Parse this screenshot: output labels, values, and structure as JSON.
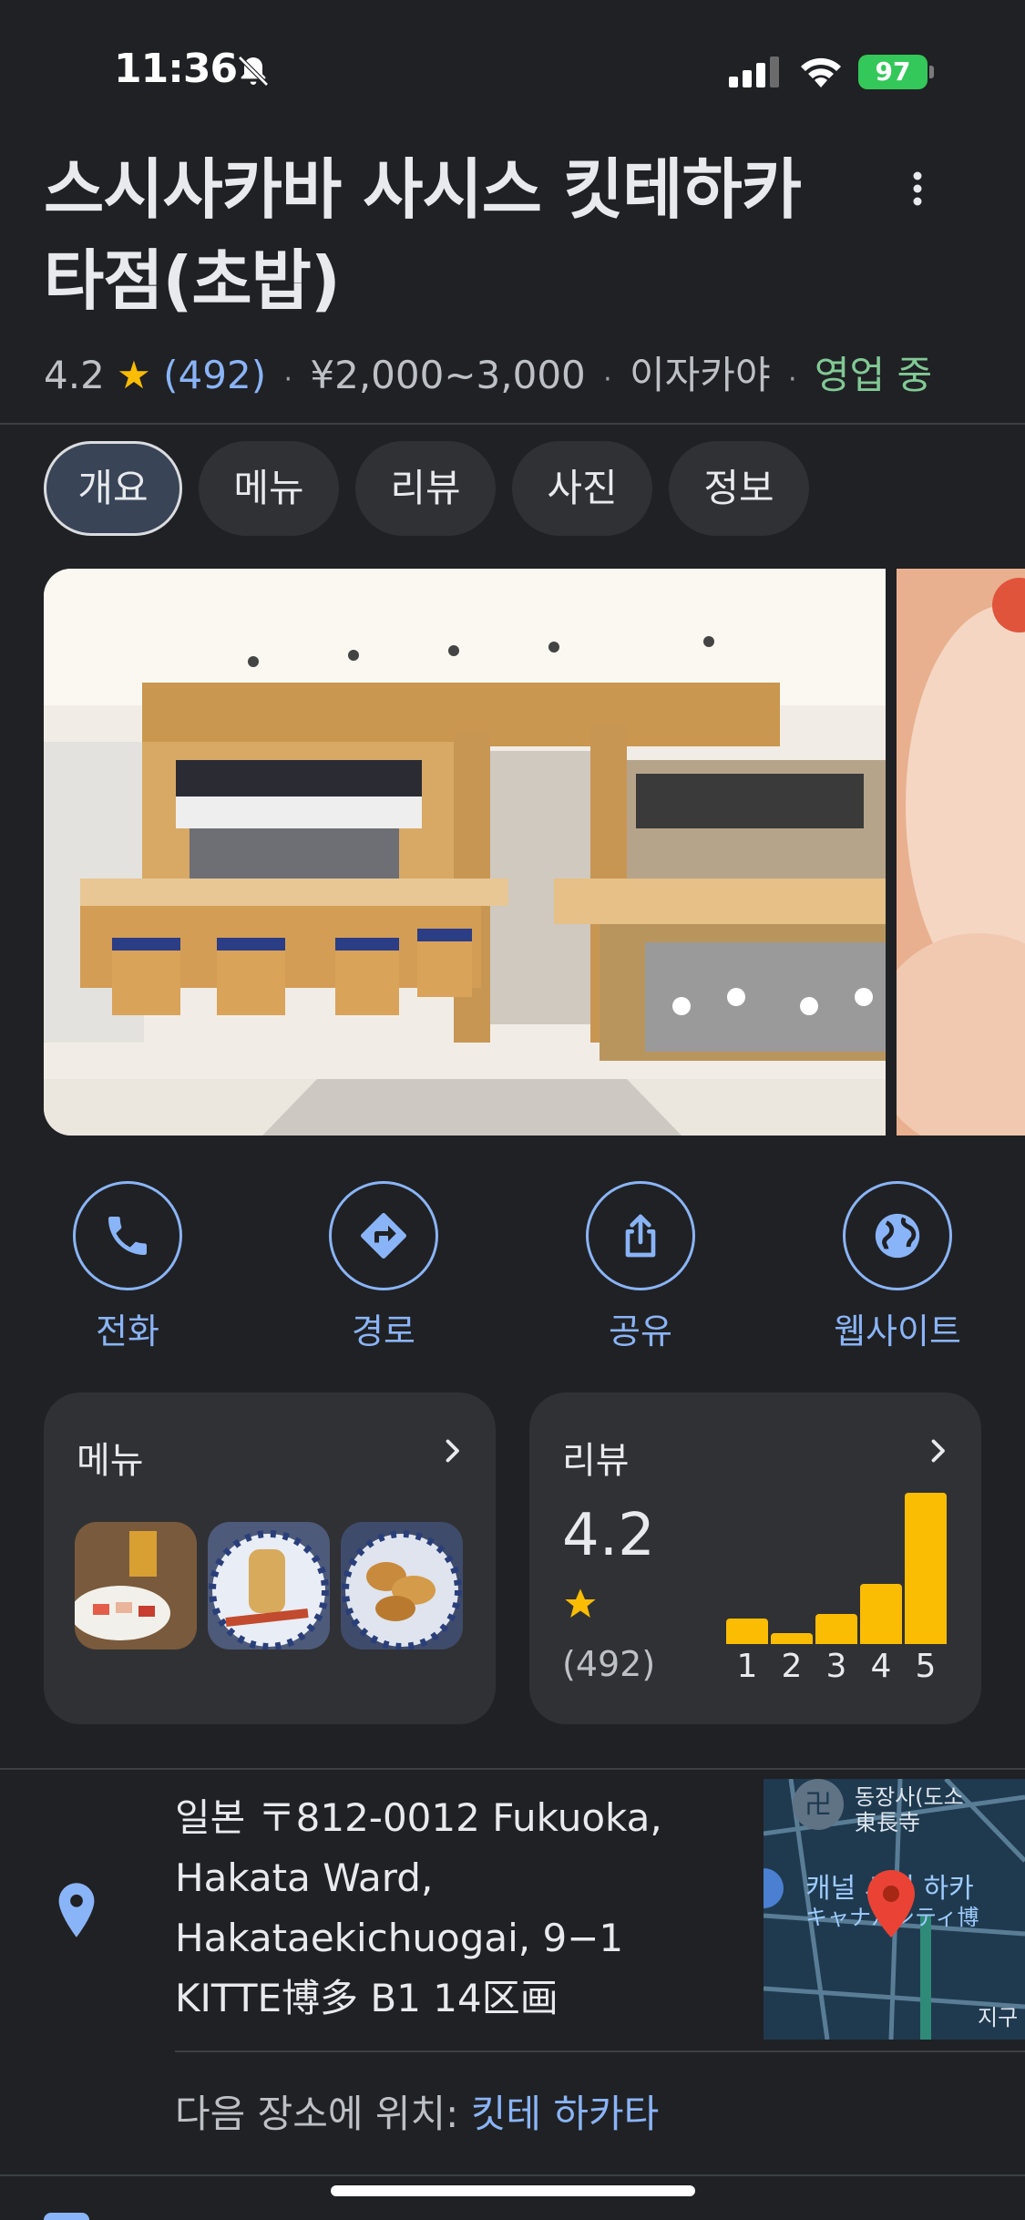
{
  "status_bar": {
    "time": "11:36",
    "battery": "97"
  },
  "place": {
    "title_line1": "스시사카바 사시스 킷테하카",
    "title_line2": "타점(초밥)",
    "rating": "4.2",
    "review_count": "(492)",
    "price": "¥2,000~3,000",
    "category": "이자카야",
    "status": "영업 중"
  },
  "tabs": [
    {
      "label": "개요",
      "active": true
    },
    {
      "label": "메뉴"
    },
    {
      "label": "리뷰"
    },
    {
      "label": "사진"
    },
    {
      "label": "정보"
    }
  ],
  "actions": [
    {
      "label": "전화",
      "icon": "phone-icon"
    },
    {
      "label": "경로",
      "icon": "directions-icon"
    },
    {
      "label": "공유",
      "icon": "share-icon"
    },
    {
      "label": "웹사이트",
      "icon": "globe-icon"
    }
  ],
  "menu_card": {
    "title": "메뉴"
  },
  "review_card": {
    "title": "리뷰",
    "rating": "4.2",
    "count": "(492)",
    "distribution": [
      {
        "label": "1",
        "fraction": 0.17
      },
      {
        "label": "2",
        "fraction": 0.07
      },
      {
        "label": "3",
        "fraction": 0.2
      },
      {
        "label": "4",
        "fraction": 0.4
      },
      {
        "label": "5",
        "fraction": 1.0
      }
    ]
  },
  "address": {
    "lines": [
      "일본 〒812-0012 Fukuoka,",
      "Hakata Ward,",
      "Hakataekichuogai, 9−1",
      "KITTE博多 B1 14区画"
    ],
    "located_prefix": "다음 장소에 위치: ",
    "located_link": "킷테 하카타"
  },
  "map": {
    "labels": [
      "동장사(도소",
      "東長寺",
      "캐널 시티 하카",
      "キャナルシティ博",
      "지구"
    ]
  },
  "colors": {
    "accent": "#8ab4f8",
    "star": "#fbbc04",
    "open": "#81c995",
    "background": "#202124",
    "card": "#303134"
  }
}
